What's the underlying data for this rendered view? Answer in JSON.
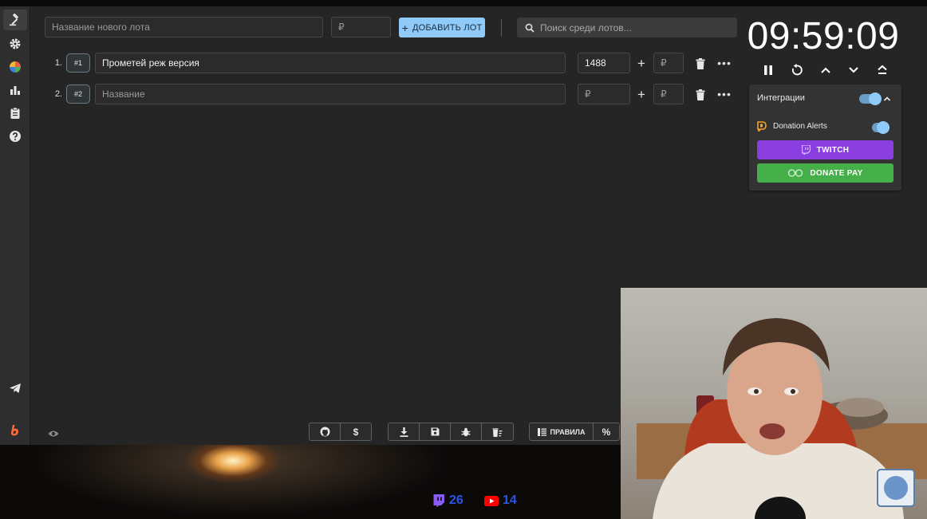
{
  "sidebar": {
    "items": [
      {
        "icon": "gavel-icon",
        "active": true
      },
      {
        "icon": "gear-icon"
      },
      {
        "icon": "pie-chart-icon"
      },
      {
        "icon": "bar-chart-icon"
      },
      {
        "icon": "clipboard-icon"
      },
      {
        "icon": "help-icon"
      }
    ],
    "bottom": [
      {
        "icon": "telegram-icon"
      },
      {
        "icon": "app-logo-icon"
      }
    ]
  },
  "topbar": {
    "new_lot_placeholder": "Название нового лота",
    "amount_placeholder": "₽",
    "add_button_label": "ДОБАВИТЬ ЛОТ",
    "search_placeholder": "Поиск среди лотов..."
  },
  "lots": [
    {
      "index": "1.",
      "badge": "#1",
      "name": "Прометей реж версия",
      "name_placeholder": "Название",
      "amount": "1488",
      "amount_placeholder": "₽",
      "add_placeholder": "₽"
    },
    {
      "index": "2.",
      "badge": "#2",
      "name": "",
      "name_placeholder": "Название",
      "amount": "",
      "amount_placeholder": "₽",
      "add_placeholder": "₽"
    }
  ],
  "timer": {
    "time": "09:59:09",
    "controls": [
      "pause-icon",
      "restart-icon",
      "chevron-up-icon",
      "chevron-down-icon",
      "eject-icon"
    ]
  },
  "integrations": {
    "title": "Интеграции",
    "enabled": true,
    "donation_alerts_label": "Donation Alerts",
    "donation_alerts_enabled": true,
    "twitch_label": "TWITCH",
    "donatepay_label": "DONATE PAY",
    "colors": {
      "twitch": "#8a3ee0",
      "donatepay": "#45b04a",
      "accent": "#90caf9"
    }
  },
  "toolbar": {
    "rules_label": "ПРАВИЛА"
  },
  "stream": {
    "twitch_viewers": "26",
    "youtube_viewers": "14"
  }
}
